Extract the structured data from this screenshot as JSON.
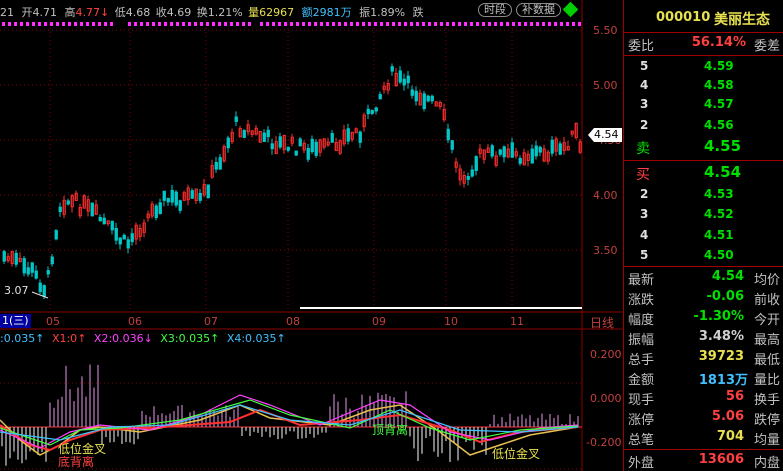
{
  "header": {
    "code_prefix": "21",
    "open_label": "开",
    "open_value": "4.71",
    "high_label": "高",
    "high_value": "4.77",
    "low_label": "低",
    "low_value": "4.68",
    "close_label": "收",
    "close_value": "4.69",
    "turnover_label": "换",
    "turnover_value": "1.21%",
    "volume_label": "量",
    "volume_value": "62967",
    "amount_label": "额",
    "amount_value": "2981万",
    "amplitude_label": "振",
    "amplitude_value": "1.89%",
    "fall_label": "跌",
    "btn_timeshare": "时段",
    "btn_supplement": "补数据"
  },
  "price_axis": [
    "5.50",
    "5.00",
    "4.50",
    "4.00",
    "3.50"
  ],
  "current_price_tag": "4.54",
  "low_annotation": "3.07",
  "period_tab": "1(三)",
  "month_labels": [
    "05",
    "06",
    "07",
    "08",
    "09",
    "10",
    "11"
  ],
  "timeframe_label": "日线",
  "indicator": {
    "x0": "0.035",
    "x1_label": "X1:0",
    "x1_arrow": "↑",
    "x2_label": "X2:0.036",
    "x2_arrow": "↓",
    "x3_label": "X3:0.035",
    "x3_arrow": "↑",
    "x4_label": "X4:0.035",
    "x4_arrow": "↑",
    "axis": [
      "0.200",
      "0.000",
      "-0.200"
    ],
    "annotations": {
      "low_gold_cross_1": "低位金叉",
      "bottom_divergence": "底背离",
      "top_divergence": "顶背离",
      "low_gold_cross_2": "低位金叉"
    }
  },
  "quote": {
    "code": "000010",
    "name": "美丽生态",
    "weibi_label": "委比",
    "weibi_value": "56.14%",
    "weicha_label": "委差",
    "sell_levels": [
      {
        "level": "5",
        "price": "4.59"
      },
      {
        "level": "4",
        "price": "4.58"
      },
      {
        "level": "3",
        "price": "4.57"
      },
      {
        "level": "2",
        "price": "4.56"
      }
    ],
    "sell1_label": "卖",
    "sell1_price": "4.55",
    "buy1_label": "买",
    "buy1_price": "4.54",
    "buy_levels": [
      {
        "level": "2",
        "price": "4.53"
      },
      {
        "level": "3",
        "price": "4.52"
      },
      {
        "level": "4",
        "price": "4.51"
      },
      {
        "level": "5",
        "price": "4.50"
      }
    ],
    "stats": [
      {
        "label": "最新",
        "value": "4.54",
        "label2": "均价",
        "color": "#00e000"
      },
      {
        "label": "涨跌",
        "value": "-0.06",
        "label2": "前收",
        "color": "#00e000"
      },
      {
        "label": "幅度",
        "value": "-1.30%",
        "label2": "今开",
        "color": "#00e000"
      },
      {
        "label": "振幅",
        "value": "3.48%",
        "label2": "最高",
        "color": "#d0d0d0"
      },
      {
        "label": "总手",
        "value": "39723",
        "label2": "最低",
        "color": "#e8e050"
      },
      {
        "label": "金额",
        "value": "1813万",
        "label2": "量比",
        "color": "#40c0ff"
      },
      {
        "label": "现手",
        "value": "56",
        "label2": "换手",
        "color": "#ff4040"
      },
      {
        "label": "涨停",
        "value": "5.06",
        "label2": "跌停",
        "color": "#ff4040"
      },
      {
        "label": "总笔",
        "value": "704",
        "label2": "均量",
        "color": "#e8e050"
      }
    ],
    "outer_label": "外盘",
    "outer_value": "13606",
    "inner_label": "内盘"
  },
  "colors": {
    "up": "#ff3030",
    "down": "#00c8c8",
    "grid": "#8b0000",
    "label": "#e0e0e0",
    "axis_text": "#c04040"
  }
}
